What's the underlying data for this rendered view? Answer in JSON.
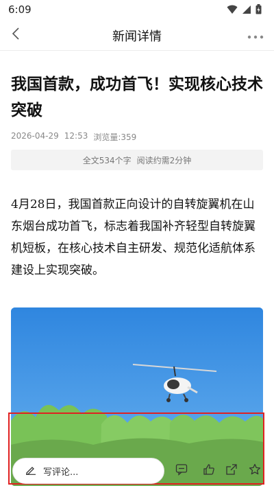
{
  "status_bar": {
    "time": "6:09"
  },
  "nav": {
    "title": "新闻详情"
  },
  "article": {
    "title": "我国首款，成功首飞！实现核心技术突破",
    "date": "2026-04-29",
    "time": "12:53",
    "views": "浏览量:359",
    "summary_words": "全文534个字",
    "summary_read_time": "阅读约需2分钟",
    "body": "4月28日，我国首款正向设计的自转旋翼机在山东烟台成功首飞，标志着我国补齐轻型自转旋翼机短板，在核心技术自主研发、规范化适航体系建设上实现突破。"
  },
  "bottom_bar": {
    "comment_placeholder": "写评论..."
  },
  "colors": {
    "highlight_border": "#e02020",
    "sky": "#3d8fe0",
    "trees": "#7cc35a"
  }
}
